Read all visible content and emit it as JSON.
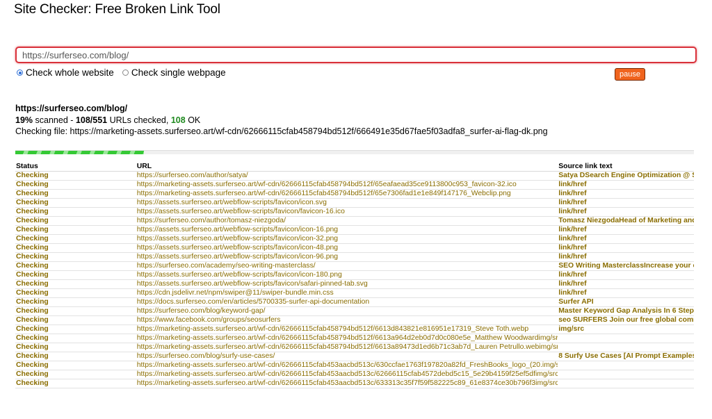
{
  "page": {
    "title": "Site Checker: Free Broken Link Tool"
  },
  "form": {
    "url_value": "https://surferseo.com/blog/",
    "mode_whole_label": "Check whole website",
    "mode_single_label": "Check single webpage",
    "selected_mode": "whole",
    "pause_label": "pause"
  },
  "status": {
    "site_url": "https://surferseo.com/blog/",
    "percent": "19%",
    "scanned_word": "scanned",
    "checked_counts": "108/551",
    "checked_suffix": "URLs checked,",
    "ok_count": "108",
    "ok_label": "OK",
    "checking_file_label": "Checking file:",
    "checking_file_url": "https://marketing-assets.surferseo.art/wf-cdn/62666115cfab458794bd512f/666491e35d67fae5f03adfa8_surfer-ai-flag-dk.png",
    "progress_fraction": 0.19
  },
  "colors": {
    "accent_red": "#d9313a",
    "pause_orange": "#f0641e",
    "ok_green": "#1f8a1f",
    "link_gold": "#8a6d00",
    "progress_green": "#35c935"
  },
  "table": {
    "headers": [
      "Status",
      "URL",
      "Source link text"
    ],
    "rows": [
      {
        "status": "Checking",
        "url": "https://surferseo.com/author/satya/",
        "source": "Satya DSearch Engine Optimization @ S"
      },
      {
        "status": "Checking",
        "url": "https://marketing-assets.surferseo.art/wf-cdn/62666115cfab458794bd512f/65eafaead35ce9113800c953_favicon-32.ico",
        "source": "link/href"
      },
      {
        "status": "Checking",
        "url": "https://marketing-assets.surferseo.art/wf-cdn/62666115cfab458794bd512f/65e7306fad1e1e849f147176_Webclip.png",
        "source": "link/href"
      },
      {
        "status": "Checking",
        "url": "https://assets.surferseo.art/webflow-scripts/favicon/icon.svg",
        "source": "link/href"
      },
      {
        "status": "Checking",
        "url": "https://assets.surferseo.art/webflow-scripts/favicon/favicon-16.ico",
        "source": "link/href"
      },
      {
        "status": "Checking",
        "url": "https://surferseo.com/author/tomasz-niezgoda/",
        "source": "Tomasz NiezgodaHead of Marketing and"
      },
      {
        "status": "Checking",
        "url": "https://assets.surferseo.art/webflow-scripts/favicon/icon-16.png",
        "source": "link/href"
      },
      {
        "status": "Checking",
        "url": "https://assets.surferseo.art/webflow-scripts/favicon/icon-32.png",
        "source": "link/href"
      },
      {
        "status": "Checking",
        "url": "https://assets.surferseo.art/webflow-scripts/favicon/icon-48.png",
        "source": "link/href"
      },
      {
        "status": "Checking",
        "url": "https://assets.surferseo.art/webflow-scripts/favicon/icon-96.png",
        "source": "link/href"
      },
      {
        "status": "Checking",
        "url": "https://surferseo.com/academy/seo-writing-masterclass/",
        "source": "SEO Writing MasterclassIncrease your co"
      },
      {
        "status": "Checking",
        "url": "https://assets.surferseo.art/webflow-scripts/favicon/icon-180.png",
        "source": "link/href"
      },
      {
        "status": "Checking",
        "url": "https://assets.surferseo.art/webflow-scripts/favicon/safari-pinned-tab.svg",
        "source": "link/href"
      },
      {
        "status": "Checking",
        "url": "https://cdn.jsdelivr.net/npm/swiper@11/swiper-bundle.min.css",
        "source": "link/href"
      },
      {
        "status": "Checking",
        "url": "https://docs.surferseo.com/en/articles/5700335-surfer-api-documentation",
        "source": "Surfer API"
      },
      {
        "status": "Checking",
        "url": "https://surferseo.com/blog/keyword-gap/",
        "source": "Master Keyword Gap Analysis In 6 Steps"
      },
      {
        "status": "Checking",
        "url": "https://www.facebook.com/groups/seosurfers",
        "source": "seo SURFERS Join our free global commu"
      },
      {
        "status": "Checking",
        "url": "https://marketing-assets.surferseo.art/wf-cdn/62666115cfab458794bd512f/6613d843821e816951e17319_Steve Toth.webp",
        "source": "img/src"
      },
      {
        "status": "Checking",
        "url": "https://marketing-assets.surferseo.art/wf-cdn/62666115cfab458794bd512f/6613a964d2eb0d7d0c080e5e_Matthew Woodwardimg/src",
        "source": ""
      },
      {
        "status": "Checking",
        "url": "https://marketing-assets.surferseo.art/wf-cdn/62666115cfab458794bd512f/6613a89473d1ed6b71c3ab7d_Lauren Petrullo.webimg/src",
        "source": ""
      },
      {
        "status": "Checking",
        "url": "https://surferseo.com/blog/surfy-use-cases/",
        "source": "8 Surfy Use Cases [AI Prompt Examples I"
      },
      {
        "status": "Checking",
        "url": "https://marketing-assets.surferseo.art/wf-cdn/62666115cfab453aacbd513c/630ccfae1763f197820a82fd_FreshBooks_logo_(20.img/src",
        "source": ""
      },
      {
        "status": "Checking",
        "url": "https://marketing-assets.surferseo.art/wf-cdn/62666115cfab453aacbd513c/62666115cfab4572debd5c15_5e29b4159f25ef5dfimg/src",
        "source": ""
      },
      {
        "status": "Checking",
        "url": "https://marketing-assets.surferseo.art/wf-cdn/62666115cfab453aacbd513c/633313c35f7f59f582225c89_61e8374ce30b796f3img/src",
        "source": ""
      }
    ]
  }
}
